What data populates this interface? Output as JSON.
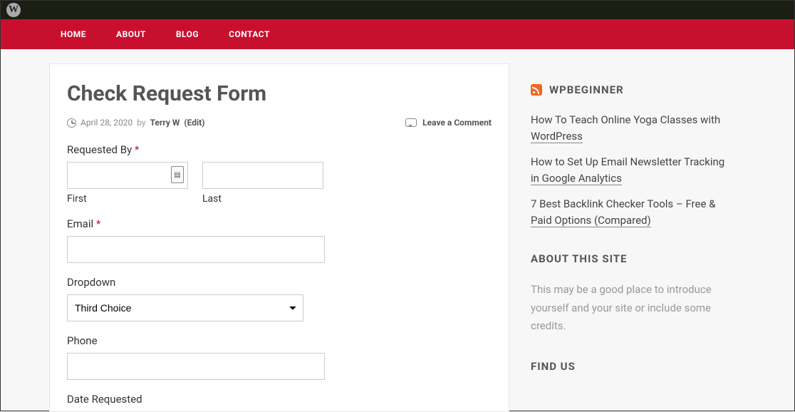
{
  "nav": {
    "items": [
      "HOME",
      "ABOUT",
      "BLOG",
      "CONTACT"
    ]
  },
  "page": {
    "title": "Check Request Form",
    "date": "April 28, 2020",
    "by": "by",
    "author": "Terry W",
    "edit": "(Edit)",
    "comment": "Leave a Comment"
  },
  "form": {
    "requested_by": {
      "label": "Requested By",
      "first": "First",
      "last": "Last"
    },
    "email": {
      "label": "Email"
    },
    "dropdown": {
      "label": "Dropdown",
      "value": "Third Choice"
    },
    "phone": {
      "label": "Phone"
    },
    "date_requested": {
      "label": "Date Requested"
    }
  },
  "sidebar": {
    "rss": {
      "title": "WPBEGINNER",
      "items": [
        {
          "line1": "How To Teach Online Yoga Classes with",
          "line2": "WordPress"
        },
        {
          "line1": "How to Set Up Email Newsletter Tracking",
          "line2": "in Google Analytics"
        },
        {
          "line1": "7 Best Backlink Checker Tools – Free &",
          "line2": "Paid Options (Compared)"
        }
      ]
    },
    "about": {
      "title": "ABOUT THIS SITE",
      "text": "This may be a good place to introduce yourself and your site or include some credits."
    },
    "find": {
      "title": "FIND US"
    }
  }
}
